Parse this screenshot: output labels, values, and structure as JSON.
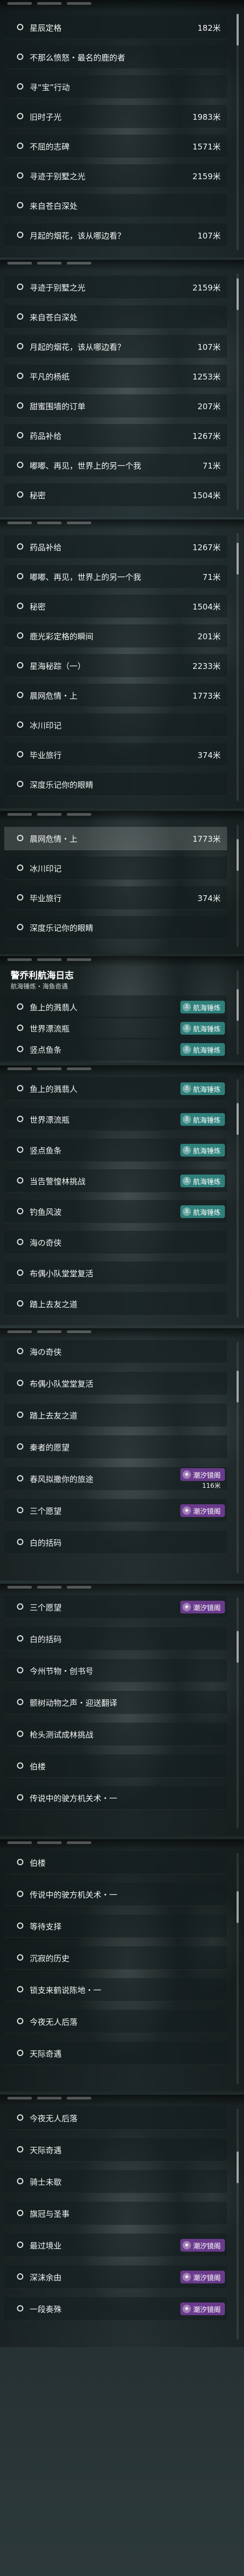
{
  "panels": [
    {
      "name": "panel-1",
      "rows": [
        {
          "label": "星辰定格",
          "dist": "182米"
        },
        {
          "label": "不那么愤怒・最名的鹿的者",
          "dist": ""
        },
        {
          "label": "寻“宝”行动",
          "dist": ""
        },
        {
          "label": "旧时子光",
          "dist": "1983米"
        },
        {
          "label": "不屈的志碑",
          "dist": "1571米"
        },
        {
          "label": "寻迹于别墅之光",
          "dist": "2159米"
        },
        {
          "label": "来自苍白深处",
          "dist": ""
        },
        {
          "label": "月起的烟花，该从哪边看？",
          "dist": "107米"
        }
      ]
    },
    {
      "name": "panel-2",
      "rows": [
        {
          "label": "寻迹于别墅之光",
          "dist": "2159米"
        },
        {
          "label": "来自苍白深处",
          "dist": ""
        },
        {
          "label": "月起的烟花，该从哪边看？",
          "dist": "107米"
        },
        {
          "label": "平凡的杨纸",
          "dist": "1253米"
        },
        {
          "label": "甜蜜围墙的订单",
          "dist": "207米"
        },
        {
          "label": "药品补给",
          "dist": "1267米"
        },
        {
          "label": "嘟嘟、再见，世界上的另一个我",
          "dist": "71米"
        },
        {
          "label": "秘密",
          "dist": "1504米"
        }
      ]
    },
    {
      "name": "panel-3",
      "rows": [
        {
          "label": "药品补给",
          "dist": "1267米"
        },
        {
          "label": "嘟嘟、再见，世界上的另一个我",
          "dist": "71米"
        },
        {
          "label": "秘密",
          "dist": "1504米"
        },
        {
          "label": "鹿光彩定格的瞬间",
          "dist": "201米"
        },
        {
          "label": "星海秘踪（一）",
          "dist": "2233米"
        },
        {
          "label": "晨网危情・上",
          "dist": "1773米"
        },
        {
          "label": "冰川印记",
          "dist": ""
        },
        {
          "label": "毕业旅行",
          "dist": "374米"
        },
        {
          "label": "深度乐记你的眼睛",
          "dist": ""
        }
      ]
    },
    {
      "name": "panel-4",
      "rows": [
        {
          "label": "晨网危情・上",
          "dist": "1773米"
        },
        {
          "label": "冰川印记",
          "dist": ""
        },
        {
          "label": "毕业旅行",
          "dist": "374米"
        },
        {
          "label": "深度乐记你的眼睛",
          "dist": ""
        }
      ]
    },
    {
      "name": "panel-5",
      "header": {
        "title": "警乔利航海日志",
        "subtitle": "航海锤炼・海鱼奇遇"
      },
      "rows": [
        {
          "label": "鱼上的溅翡人",
          "dist": "",
          "badge": "航海锤炼",
          "badge_type": "quest"
        },
        {
          "label": "世界漂流瓶",
          "dist": "",
          "badge": "航海锤炼",
          "badge_type": "quest"
        },
        {
          "label": "竖点鱼条",
          "dist": "",
          "badge": "航海锤炼",
          "badge_type": "quest"
        }
      ]
    },
    {
      "name": "panel-6",
      "rows": [
        {
          "label": "鱼上的溅翡人",
          "dist": "",
          "badge": "航海锤炼",
          "badge_type": "quest"
        },
        {
          "label": "世界漂流瓶",
          "dist": "",
          "badge": "航海锤炼",
          "badge_type": "quest"
        },
        {
          "label": "竖点鱼条",
          "dist": "",
          "badge": "航海锤炼",
          "badge_type": "quest"
        },
        {
          "label": "当告警惶林挑战",
          "dist": "",
          "badge": "航海锤炼",
          "badge_type": "quest"
        },
        {
          "label": "钓鱼风波",
          "dist": "",
          "badge": "航海锤炼",
          "badge_type": "quest"
        },
        {
          "label": "海の奇侠",
          "dist": ""
        },
        {
          "label": "布偶小队堂堂复活",
          "dist": ""
        },
        {
          "label": "踏上去友之道",
          "dist": ""
        }
      ]
    },
    {
      "name": "panel-7",
      "rows": [
        {
          "label": "海の奇侠",
          "dist": ""
        },
        {
          "label": "布偶小队堂堂复活",
          "dist": ""
        },
        {
          "label": "踏上去友之道",
          "dist": ""
        },
        {
          "label": "秦者的愿望",
          "dist": ""
        },
        {
          "label": "春风拟撒你的旅途",
          "dist": "116米",
          "badge": "潮汐镜阁",
          "badge_type": "event"
        },
        {
          "label": "三个愿望",
          "dist": "",
          "badge": "潮汐镜阁",
          "badge_type": "event"
        },
        {
          "label": "白的括码",
          "dist": ""
        }
      ]
    },
    {
      "name": "panel-8",
      "rows": [
        {
          "label": "三个愿望",
          "dist": "",
          "badge": "潮汐镜阁",
          "badge_type": "event"
        },
        {
          "label": "白的括码",
          "dist": ""
        },
        {
          "label": "今州节物・创书号",
          "dist": ""
        },
        {
          "label": "颤树动物之声・迎送翻译",
          "dist": ""
        },
        {
          "label": "枪头测试成林挑战",
          "dist": ""
        },
        {
          "label": "伯楼",
          "dist": ""
        },
        {
          "label": "传说中的驶方机关术・一",
          "dist": ""
        }
      ]
    },
    {
      "name": "panel-9",
      "rows": [
        {
          "label": "伯楼",
          "dist": ""
        },
        {
          "label": "传说中的驶方机关术・一",
          "dist": ""
        },
        {
          "label": "等待支择",
          "dist": ""
        },
        {
          "label": "沉寂的历史",
          "dist": ""
        },
        {
          "label": "锁支来鹤说陈地・一",
          "dist": ""
        },
        {
          "label": "今夜无人后落",
          "dist": ""
        },
        {
          "label": "天际奇遇",
          "dist": ""
        }
      ]
    },
    {
      "name": "panel-10",
      "rows": [
        {
          "label": "今夜无人后落",
          "dist": ""
        },
        {
          "label": "天际奇遇",
          "dist": ""
        },
        {
          "label": "骑士未歇",
          "dist": ""
        },
        {
          "label": "旗冠与圣事",
          "dist": ""
        },
        {
          "label": "最过境业",
          "dist": "",
          "badge": "潮汐镜阁",
          "badge_type": "event"
        },
        {
          "label": "深沫余由",
          "dist": "",
          "badge": "潮汐镜阁",
          "badge_type": "event"
        },
        {
          "label": "一段奏殊",
          "dist": "",
          "badge": "潮汐镜阁",
          "badge_type": "event"
        }
      ]
    }
  ]
}
